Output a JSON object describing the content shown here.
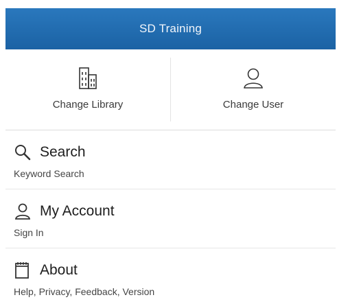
{
  "header": {
    "title": "SD Training"
  },
  "actions": [
    {
      "label": "Change Library",
      "icon": "library-building-icon"
    },
    {
      "label": "Change User",
      "icon": "user-icon"
    }
  ],
  "menu": [
    {
      "title": "Search",
      "subtitle": "Keyword Search",
      "icon": "search-icon"
    },
    {
      "title": "My Account",
      "subtitle": "Sign In",
      "icon": "user-icon"
    },
    {
      "title": "About",
      "subtitle": "Help, Privacy, Feedback, Version",
      "icon": "notepad-icon"
    }
  ],
  "colors": {
    "header_bg": "#1f6cb0",
    "header_text": "#f2f6fb",
    "divider": "#e3e3e3"
  }
}
